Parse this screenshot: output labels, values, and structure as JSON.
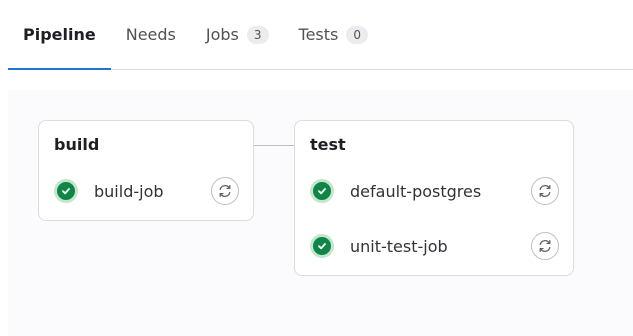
{
  "tabs": [
    {
      "label": "Pipeline",
      "active": true
    },
    {
      "label": "Needs"
    },
    {
      "label": "Jobs",
      "count": "3"
    },
    {
      "label": "Tests",
      "count": "0"
    }
  ],
  "stages": [
    {
      "title": "build",
      "jobs": [
        {
          "name": "build-job",
          "status": "success",
          "icon": "check-circle-icon",
          "action_icon": "retry-icon"
        }
      ]
    },
    {
      "title": "test",
      "jobs": [
        {
          "name": "default-postgres",
          "status": "success",
          "icon": "check-circle-icon",
          "action_icon": "retry-icon"
        },
        {
          "name": "unit-test-job",
          "status": "success",
          "icon": "check-circle-icon",
          "action_icon": "retry-icon"
        }
      ]
    }
  ],
  "colors": {
    "accent": "#1f75cb",
    "success": "#108548",
    "success_light": "#c3e6cd"
  }
}
